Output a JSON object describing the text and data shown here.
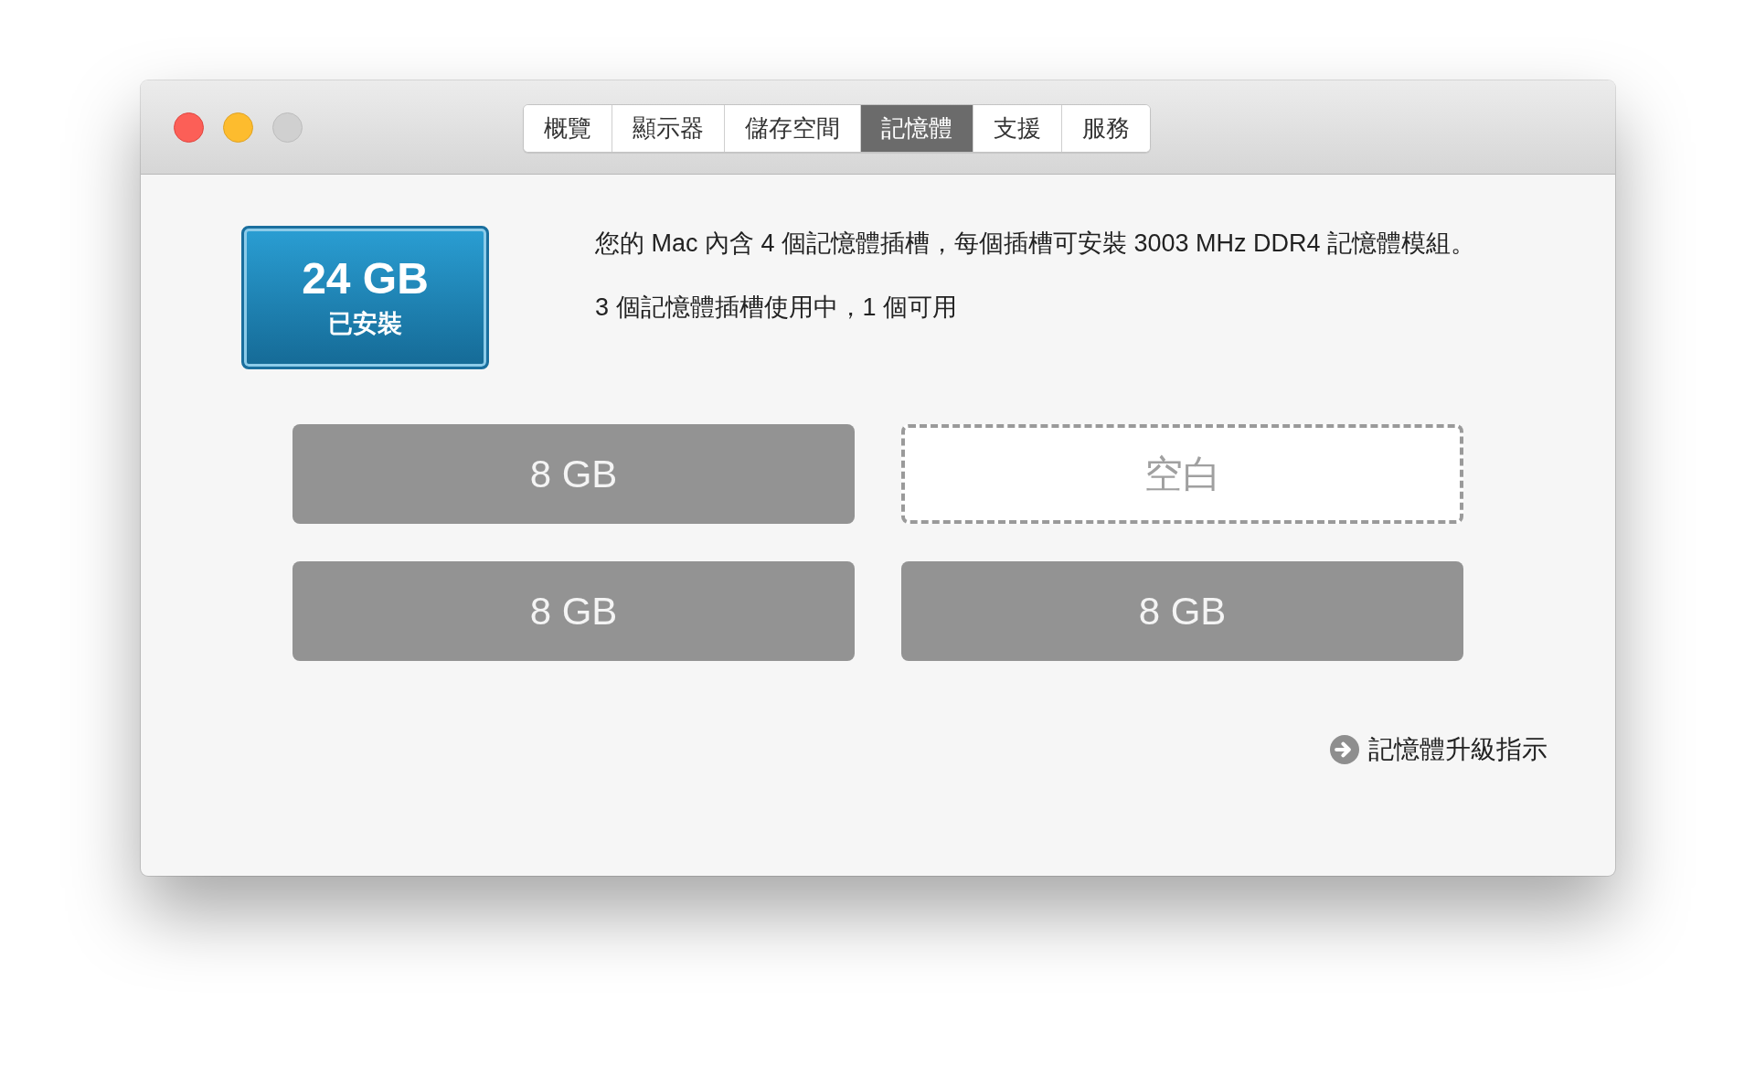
{
  "window": {
    "controls": [
      {
        "kind": "close",
        "disabled": false
      },
      {
        "kind": "minimize",
        "disabled": false
      },
      {
        "kind": "zoom",
        "disabled": true
      }
    ]
  },
  "tabs": [
    {
      "label": "概覽",
      "selected": false
    },
    {
      "label": "顯示器",
      "selected": false
    },
    {
      "label": "儲存空間",
      "selected": false
    },
    {
      "label": "記憶體",
      "selected": true
    },
    {
      "label": "支援",
      "selected": false
    },
    {
      "label": "服務",
      "selected": false
    }
  ],
  "summary": {
    "amount": "24 GB",
    "caption": "已安裝"
  },
  "description": [
    "您的 Mac 內含 4 個記憶體插槽，每個插槽可安裝 3003 MHz DDR4 記憶體模組。",
    "3 個記憶體插槽使用中，1 個可用"
  ],
  "slots": [
    {
      "kind": "module",
      "label": "8 GB"
    },
    {
      "kind": "empty",
      "label": "空白"
    },
    {
      "kind": "module",
      "label": "8 GB"
    },
    {
      "kind": "module",
      "label": "8 GB"
    }
  ],
  "link": {
    "label": "記憶體升級指示"
  }
}
